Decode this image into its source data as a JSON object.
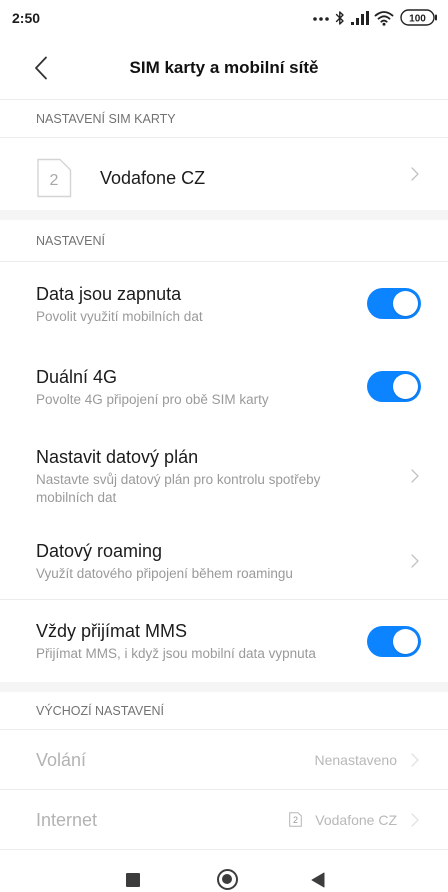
{
  "status_bar": {
    "time": "2:50",
    "icons": [
      "more-dots-icon",
      "bluetooth-icon",
      "signal-icon",
      "wifi-icon",
      "battery-icon"
    ],
    "battery": "100"
  },
  "header": {
    "back_icon": "chevron-left-icon",
    "title": "SIM karty a mobilní sítě"
  },
  "sim_section": {
    "header": "NASTAVENÍ SIM KARTY",
    "sim": {
      "slot": "2",
      "name": "Vodafone CZ",
      "icon": "sim-card-icon"
    }
  },
  "settings_section": {
    "header": "NASTAVENÍ",
    "items": [
      {
        "title": "Data jsou zapnuta",
        "subtitle": "Povolit využití mobilních dat",
        "control": "toggle",
        "on": true
      },
      {
        "title": "Duální 4G",
        "subtitle": "Povolte 4G připojení pro obě SIM karty",
        "control": "toggle",
        "on": true
      },
      {
        "title": "Nastavit datový plán",
        "subtitle": "Nastavte svůj datový plán pro kontrolu spotřeby mobilních dat",
        "control": "chevron"
      },
      {
        "title": "Datový roaming",
        "subtitle": "Využít datového připojení během roamingu",
        "control": "chevron"
      },
      {
        "title": "Vždy přijímat MMS",
        "subtitle": "Přijímat MMS, i když jsou mobilní data vypnuta",
        "control": "toggle",
        "on": true
      }
    ]
  },
  "default_section": {
    "header": "VÝCHOZÍ NASTAVENÍ",
    "items": [
      {
        "title": "Volání",
        "value": "Nenastaveno",
        "enabled": false
      },
      {
        "title": "Internet",
        "value": "Vodafone CZ",
        "sim_slot": "2",
        "enabled": false
      }
    ]
  },
  "nav_bar": {
    "icons": [
      "recents-square-icon",
      "home-circle-icon",
      "back-triangle-icon"
    ]
  },
  "colors": {
    "accent": "#0d84ff"
  }
}
